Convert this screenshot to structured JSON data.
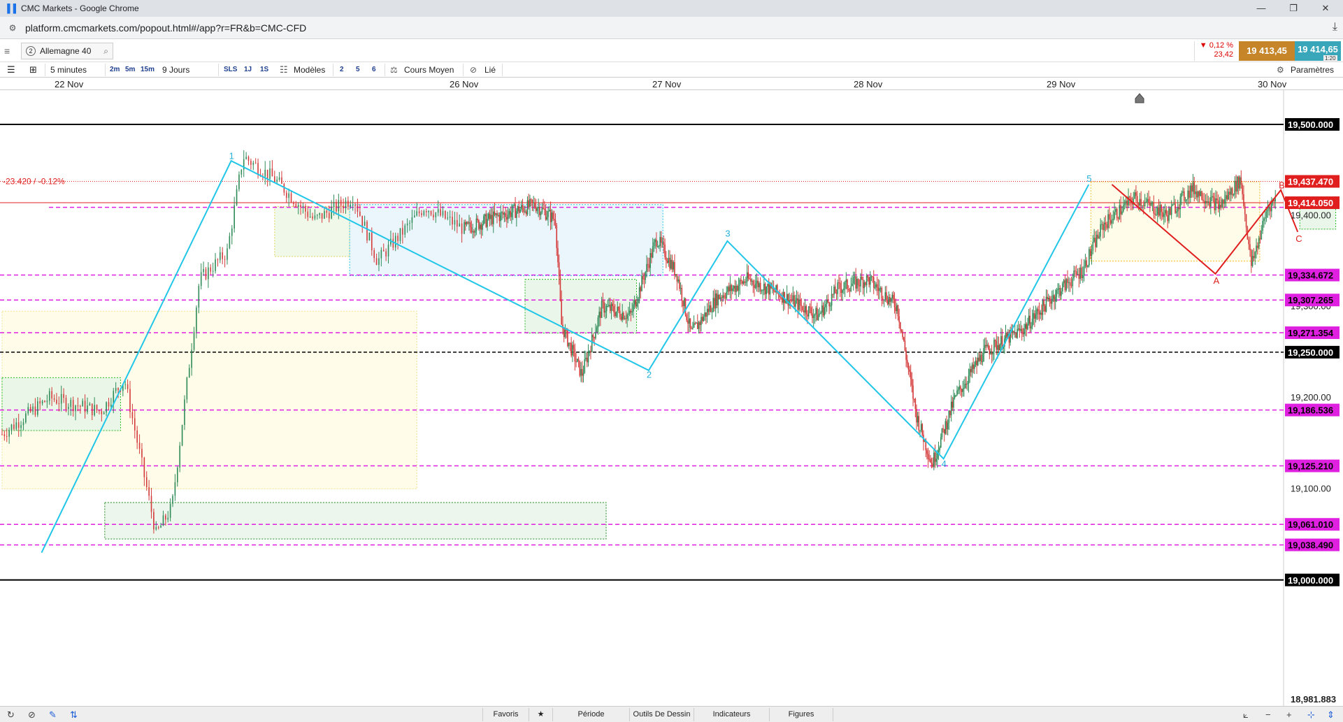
{
  "window": {
    "title": "CMC Markets - Google Chrome",
    "url": "platform.cmcmarkets.com/popout.html#/app?r=FR&b=CMC-CFD"
  },
  "instrument": {
    "tab_number": "2",
    "name": "Allemagne 40",
    "change_pct": "0,12 %",
    "change_pts": "23,42",
    "sell_price": "19 413,45",
    "buy_price": "19 414,65",
    "leverage": "1:20"
  },
  "toolbar": {
    "interval": "5 minutes",
    "quick_2m": "2m",
    "quick_5m": "5m",
    "quick_15m": "15m",
    "range": "9 Jours",
    "sls": "SLS",
    "one_j": "1J",
    "one_s": "1S",
    "templates": "Modèles",
    "t2": "2",
    "t5": "5",
    "t6": "6",
    "price_type": "Cours Moyen",
    "linked": "Lié",
    "settings": "Paramètres"
  },
  "dates": [
    "22 Nov",
    "26 Nov",
    "27 Nov",
    "28 Nov",
    "29 Nov",
    "30 Nov"
  ],
  "bottom": {
    "favoris": "Favoris",
    "periode": "Période",
    "outils": "Outils De Dessin",
    "indicateurs": "Indicateurs",
    "figures": "Figures"
  },
  "chart_data": {
    "type": "candlestick",
    "instrument": "Allemagne 40",
    "interval": "5 minutes",
    "ylim": [
      18981.883,
      19640
    ],
    "last_price": 19414.05,
    "change_label": "-23.420 / -0.12%",
    "y_ticks": [
      19400,
      19300,
      19200,
      19100
    ],
    "y_tick_labels": [
      "19,400.00",
      "19,300.00",
      "19,200.00",
      "19,100.00"
    ],
    "bottom_label": "18,981.883",
    "black_levels": [
      {
        "value": 19500,
        "label": "19,500.000",
        "style": "solid"
      },
      {
        "value": 19250,
        "label": "19,250.000",
        "style": "dashed"
      },
      {
        "value": 19000,
        "label": "19,000.000",
        "style": "solid"
      }
    ],
    "magenta_levels": [
      {
        "value": 19334.672,
        "label": "19,334.672"
      },
      {
        "value": 19307.265,
        "label": "19,307.265"
      },
      {
        "value": 19271.354,
        "label": "19,271.354"
      },
      {
        "value": 19186.536,
        "label": "19,186.536"
      },
      {
        "value": 19125.21,
        "label": "19,125.210"
      },
      {
        "value": 19061.01,
        "label": "19,061.010"
      },
      {
        "value": 19038.49,
        "label": "19,038.490"
      }
    ],
    "red_levels": [
      {
        "value": 19437.47,
        "label": "19,437.470",
        "style": "dotted"
      },
      {
        "value": 19414.05,
        "label": "19,414.050",
        "style": "solid"
      }
    ],
    "wave_labels": [
      {
        "label": "1",
        "value": 19465,
        "day_pos": 0.41
      },
      {
        "label": "2",
        "value": 19225,
        "day_pos": 1.91
      },
      {
        "label": "3",
        "value": 19380,
        "day_pos": 2.3
      },
      {
        "label": "4",
        "value": 19127,
        "day_pos": 3.39
      },
      {
        "label": "5",
        "value": 19440,
        "day_pos": 4.13
      },
      {
        "label": "A",
        "value": 19328,
        "day_pos": 4.73
      },
      {
        "label": "B",
        "value": 19433,
        "day_pos": 5.04
      },
      {
        "label": "C",
        "value": 19374,
        "day_pos": 5.12
      }
    ],
    "colors": {
      "candle_up": "#2e8b57",
      "candle_down": "#d43a3a",
      "wave_line": "#22c6e8",
      "abc_line": "#e01e1e",
      "magenta": "#e020e0"
    }
  }
}
